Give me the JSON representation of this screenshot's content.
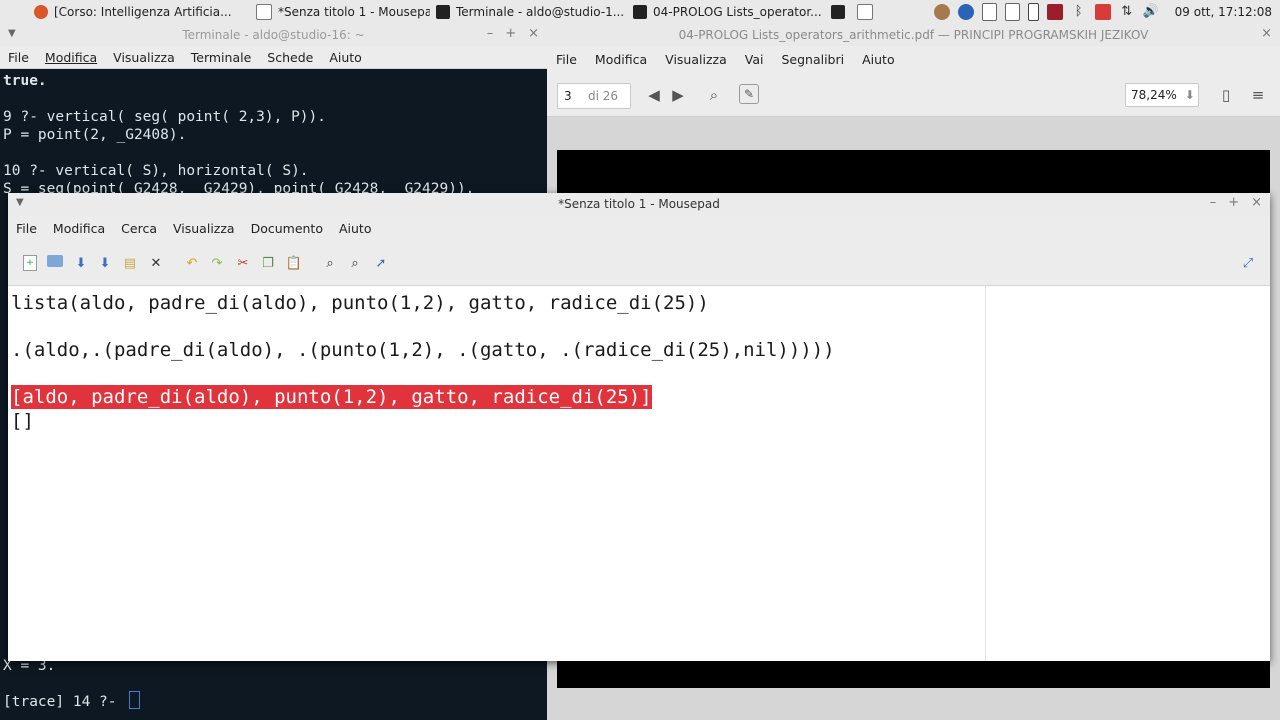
{
  "panel": {
    "tasks": [
      {
        "label": "[Corso: Intelligenza Artificia..."
      },
      {
        "label": "*Senza titolo 1 - Mousepad"
      },
      {
        "label": "Terminale - aldo@studio-1..."
      },
      {
        "label": "04-PROLOG Lists_operator..."
      }
    ],
    "clock": "09 ott, 17:12:08"
  },
  "terminal": {
    "title": "Terminale - aldo@studio-16: ~",
    "menu": [
      "File",
      "Modifica",
      "Visualizza",
      "Terminale",
      "Schede",
      "Aiuto"
    ],
    "lines": [
      "true.",
      "",
      "9 ?- vertical( seg( point( 2,3), P)).",
      "P = point(2, _G2408).",
      "",
      "10 ?- vertical( S), horizontal( S).",
      "S = seg(point(_G2428, _G2429), point(_G2428, _G2429))."
    ],
    "last_output": "X = 3.",
    "prompt": "[trace] 14 ?- "
  },
  "pdf": {
    "title": "04-PROLOG Lists_operators_arithmetic.pdf — PRINCIPI PROGRAMSKIH JEZIKOV",
    "menu": [
      "File",
      "Modifica",
      "Visualizza",
      "Vai",
      "Segnalibri",
      "Aiuto"
    ],
    "page_number": "3",
    "page_total": "di 26",
    "zoom": "78,24%"
  },
  "mousepad": {
    "title": "*Senza titolo 1 - Mousepad",
    "menu": [
      "File",
      "Modifica",
      "Cerca",
      "Visualizza",
      "Documento",
      "Aiuto"
    ],
    "lines": {
      "l1": "lista(aldo, padre_di(aldo), punto(1,2), gatto, radice_di(25))",
      "l2": ".(aldo,.(padre_di(aldo), .(punto(1,2), .(gatto, .(radice_di(25),nil)))))",
      "l3": "[aldo, padre_di(aldo), punto(1,2), gatto, radice_di(25)]",
      "l4": "[]"
    }
  }
}
